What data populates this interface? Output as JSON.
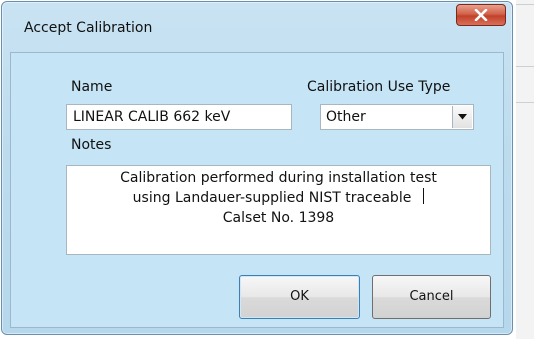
{
  "dialog": {
    "title": "Accept Calibration",
    "close_icon": "close-x-icon"
  },
  "form": {
    "name_label": "Name",
    "name_value": "LINEAR CALIB 662 keV",
    "use_type_label": "Calibration Use Type",
    "use_type_value": "Other",
    "notes_label": "Notes",
    "notes_lines": [
      "Calibration performed during installation test",
      "using Landauer-supplied NIST traceable",
      "Calset No. 1398"
    ]
  },
  "buttons": {
    "ok": "OK",
    "cancel": "Cancel"
  },
  "colors": {
    "dialog_bg": "#c5e4f5",
    "close_button": "#c2412a"
  }
}
